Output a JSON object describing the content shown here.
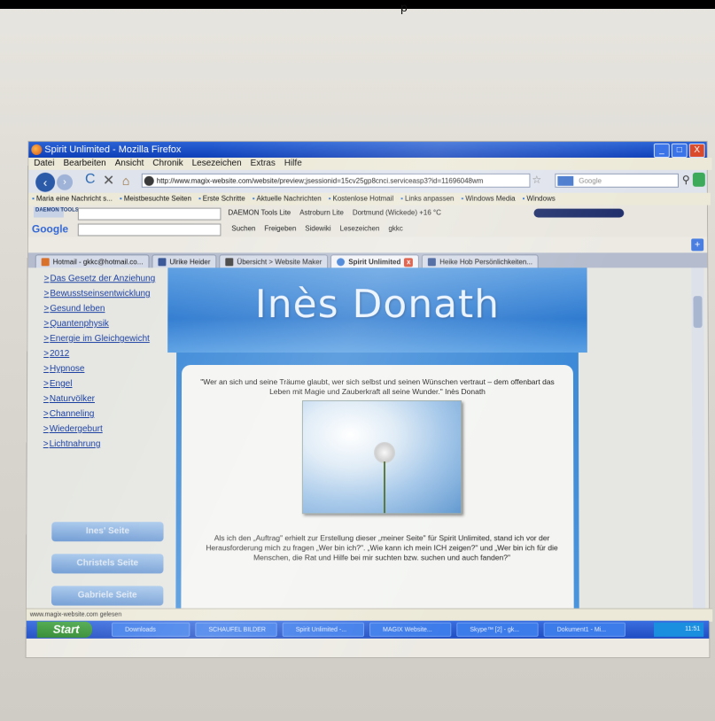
{
  "top_text": "p",
  "window": {
    "title": "Spirit Unlimited - Mozilla Firefox",
    "controls": [
      "_",
      "□",
      "X"
    ]
  },
  "menu": [
    "Datei",
    "Bearbeiten",
    "Ansicht",
    "Chronik",
    "Lesezeichen",
    "Extras",
    "Hilfe"
  ],
  "nav": {
    "url": "http://www.magix-website.com/website/preview;jsessionid=15cv25gp8cnci.serviceasp3?id=11696048wm",
    "search_placeholder": "Google"
  },
  "bookmarks": [
    "Maria eine Nachricht s...",
    "Meistbesuchte Seiten",
    "Erste Schritte",
    "Aktuelle Nachrichten",
    "Kostenlose Hotmail",
    "Links anpassen",
    "Windows Media",
    "Windows"
  ],
  "daemon_toolbar": {
    "logo": "DAEMON TOOLS",
    "items": [
      "DAEMON Tools Lite",
      "Astroburn Lite",
      "Dortmund (Wickede) +16 °C"
    ]
  },
  "google_toolbar": {
    "logo": "Google",
    "items": [
      "Suchen",
      "Freigeben",
      "Sidewiki",
      "Lesezeichen",
      "gkkc"
    ]
  },
  "tabs": [
    {
      "label": "Hotmail - gkkc@hotmail.co...",
      "active": false,
      "color": "#d9712b"
    },
    {
      "label": "Ulrike Heider",
      "active": false,
      "color": "#3b5998"
    },
    {
      "label": "Übersicht > Website Maker",
      "active": false,
      "color": "#444444"
    },
    {
      "label": "Spirit Unlimited",
      "active": true,
      "color": "#3a7bd5"
    },
    {
      "label": "Heike Hob Persönlichkeiten...",
      "active": false,
      "color": "#3b5998"
    }
  ],
  "left_nav": [
    "Das Gesetz der Anziehung",
    "Bewusstseinsentwicklung",
    "Gesund leben",
    "Quantenphysik",
    "Energie im Gleichgewicht",
    "2012",
    "Hypnose",
    "Engel",
    "Naturvölker",
    "Channeling",
    "Wiedergeburt",
    "Lichtnahrung"
  ],
  "side_buttons": [
    "Ines' Seite",
    "Christels Seite",
    "Gabriele Seite"
  ],
  "hero_title": "Inès Donath",
  "quote": "\"Wer an sich und seine Träume glaubt, wer sich selbst und seinen Wünschen vertraut – dem offenbart das Leben mit Magie und Zauberkraft all seine Wunder.\" Inès Donath",
  "intro": "Als ich den „Auftrag\" erhielt zur Erstellung dieser „meiner Seite\" für Spirit Unlimited, stand ich vor der Herausforderung mich zu fragen „Wer bin ich?\". „Wie kann ich mein ICH zeigen?\" und „Wer bin ich für die Menschen, die Rat und Hilfe bei mir suchten bzw. suchen und auch fanden?\"",
  "status": "www.magix-website.com gelesen",
  "taskbar": {
    "start": "Start",
    "items": [
      "Downloads",
      "SCHAUFEL BILDER",
      "Spirit Unlimited -...",
      "MAGIX Website...",
      "Skype™ [2] - gk...",
      "Dokument1 - Mi..."
    ],
    "clock": "11:51"
  }
}
